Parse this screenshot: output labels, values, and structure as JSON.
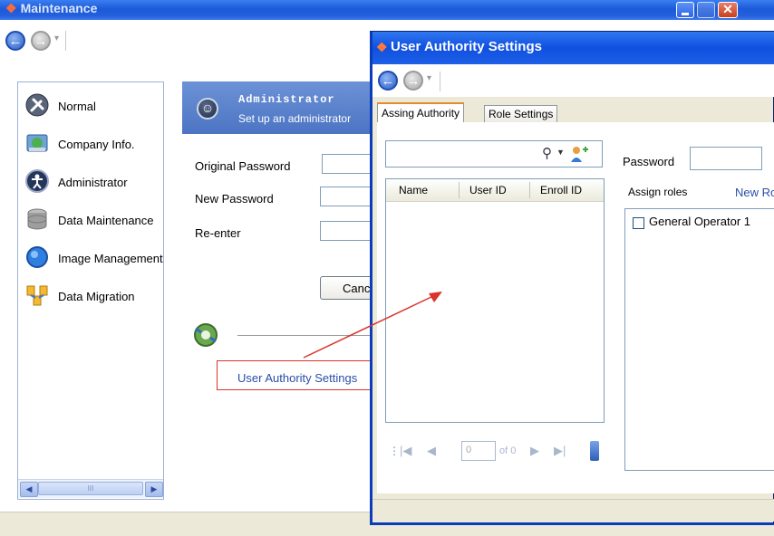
{
  "main_window": {
    "title": "Maintenance",
    "sidebar": {
      "items": [
        {
          "label": "Normal",
          "icon": "wrench-icon"
        },
        {
          "label": "Company Info.",
          "icon": "company-info-icon"
        },
        {
          "label": "Administrator",
          "icon": "administrator-icon"
        },
        {
          "label": "Data Maintenance",
          "icon": "database-icon"
        },
        {
          "label": "Image Management",
          "icon": "image-globe-icon"
        },
        {
          "label": "Data Migration",
          "icon": "data-migration-icon"
        }
      ],
      "scroll_thumb": "III"
    },
    "admin_panel": {
      "title": "Administrator",
      "subtitle": "Set up an administrator",
      "fields": [
        {
          "label": "Original Password"
        },
        {
          "label": "New Password"
        },
        {
          "label": "Re-enter"
        }
      ],
      "cancel_label": "Cancel"
    },
    "user_authority_link": "User Authority Settings",
    "highlight_color": "#d9332b"
  },
  "dialog": {
    "title": "User Authority Settings",
    "tabs": [
      {
        "label": "Assing Authority",
        "active": true
      },
      {
        "label": "Role Settings",
        "active": false
      }
    ],
    "search": {
      "value": "",
      "placeholder": ""
    },
    "grid": {
      "columns": [
        "Name",
        "User ID",
        "Enroll ID"
      ],
      "rows": []
    },
    "pager": {
      "position": "0",
      "of_text": "of 0"
    },
    "password_label": "Password",
    "assign_roles_label": "Assign roles",
    "new_role_link": "New Role",
    "roles": [
      {
        "label": "General Operator 1",
        "checked": false
      }
    ]
  },
  "colors": {
    "titlebar_blue": "#1c5ad8",
    "link_blue": "#2a4ea8",
    "annotation_red": "#d9332b"
  }
}
